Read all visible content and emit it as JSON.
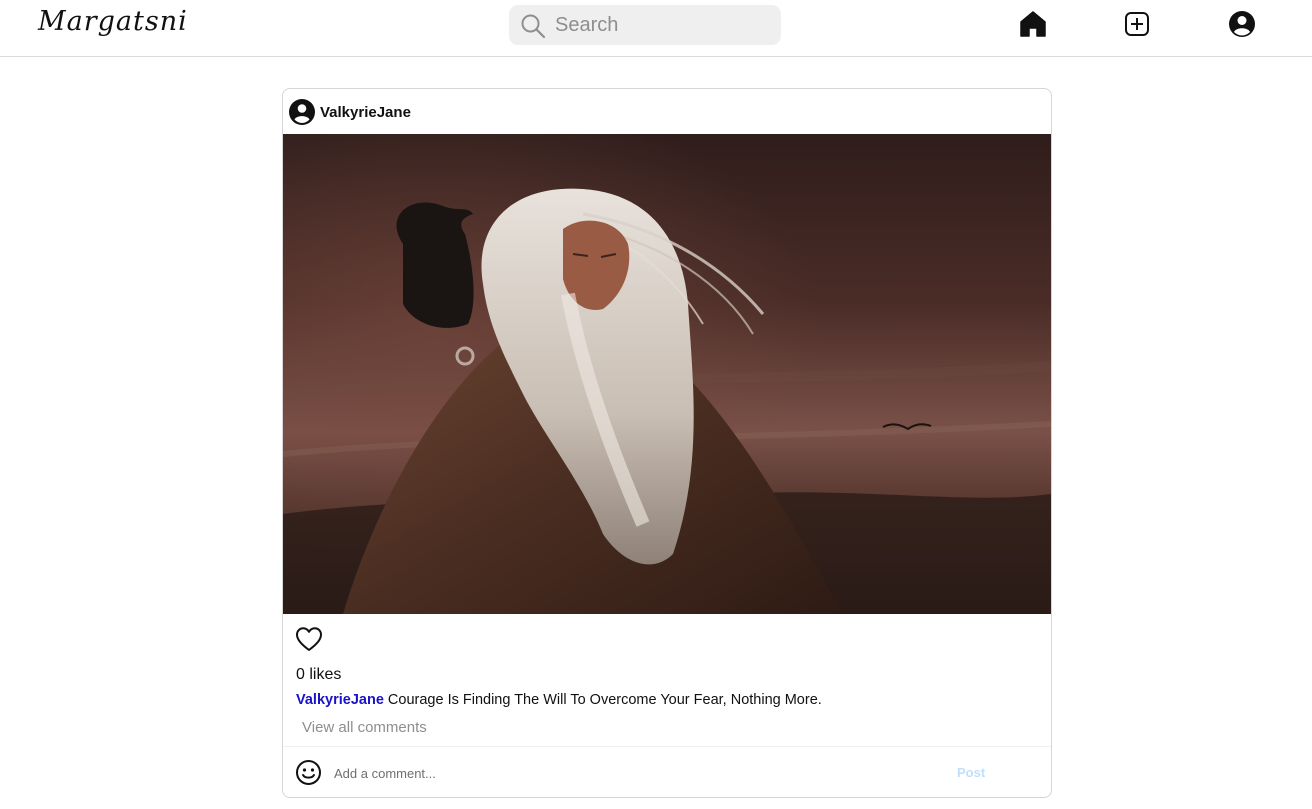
{
  "header": {
    "logo": "Margatsni",
    "search": {
      "placeholder": "Search",
      "value": ""
    },
    "nav": {
      "home": "home-icon",
      "create": "plus-square-icon",
      "profile": "account-circle-icon"
    }
  },
  "post": {
    "username": "ValkyrieJane",
    "likes_text": "0 likes",
    "caption_user": "ValkyrieJane",
    "caption_text": "Courage Is Finding The Will To Overcome Your Fear, Nothing More.",
    "view_comments": "View all comments",
    "comment_placeholder": "Add a comment...",
    "post_label": "Post"
  },
  "colors": {
    "caption_user": "#1a12c9",
    "post_button_disabled": "#c0dffd",
    "search_bg": "#efefef"
  }
}
